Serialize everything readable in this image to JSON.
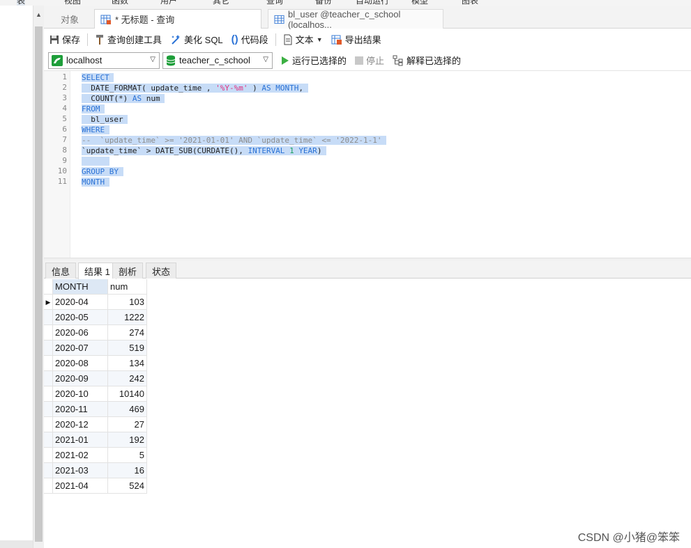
{
  "top_menu": [
    "表",
    "视图",
    "函数",
    "用户",
    "其它",
    "查询",
    "备份",
    "自动运行",
    "模型",
    "图表"
  ],
  "tabs": {
    "objects": "对象",
    "query": "* 无标题 - 查询",
    "table": "bl_user @teacher_c_school (localhos..."
  },
  "toolbar": {
    "save": "保存",
    "query_builder": "查询创建工具",
    "beautify": "美化 SQL",
    "snippet": "代码段",
    "text": "文本",
    "export": "导出结果"
  },
  "connection_bar": {
    "connection": "localhost",
    "database": "teacher_c_school",
    "run_selected": "运行已选择的",
    "stop": "停止",
    "explain_selected": "解释已选择的"
  },
  "editor": {
    "line_numbers": [
      "1",
      "2",
      "3",
      "4",
      "5",
      "6",
      "7",
      "8",
      "9",
      "10",
      "11"
    ],
    "code_lines": [
      "SELECT",
      "  DATE_FORMAT( update_time , '%Y-%m' ) AS MONTH,",
      "  COUNT(*) AS num",
      "FROM",
      "  bl_user",
      "WHERE",
      "--  `update_time` >= '2021-01-01' AND `update_time` <= '2022-1-1'",
      "`update_time` > DATE_SUB(CURDATE(), INTERVAL 1 YEAR)",
      "",
      "GROUP BY",
      "MONTH"
    ]
  },
  "result_tabs": [
    "信息",
    "结果 1",
    "剖析",
    "状态"
  ],
  "result_grid": {
    "columns": [
      "MONTH",
      "num"
    ],
    "rows": [
      [
        "2020-04",
        "103"
      ],
      [
        "2020-05",
        "1222"
      ],
      [
        "2020-06",
        "274"
      ],
      [
        "2020-07",
        "519"
      ],
      [
        "2020-08",
        "134"
      ],
      [
        "2020-09",
        "242"
      ],
      [
        "2020-10",
        "10140"
      ],
      [
        "2020-11",
        "469"
      ],
      [
        "2020-12",
        "27"
      ],
      [
        "2021-01",
        "192"
      ],
      [
        "2021-02",
        "5"
      ],
      [
        "2021-03",
        "16"
      ],
      [
        "2021-04",
        "524"
      ]
    ]
  },
  "watermark": "CSDN @小猪@笨笨",
  "colors": {
    "keyword": "#2a72d6",
    "string": "#e0307f",
    "number": "#19a05f",
    "comment": "#8c8c8c",
    "selection": "#c7dcf7",
    "run_green": "#3cb043",
    "db_green": "#1e9e3a"
  }
}
